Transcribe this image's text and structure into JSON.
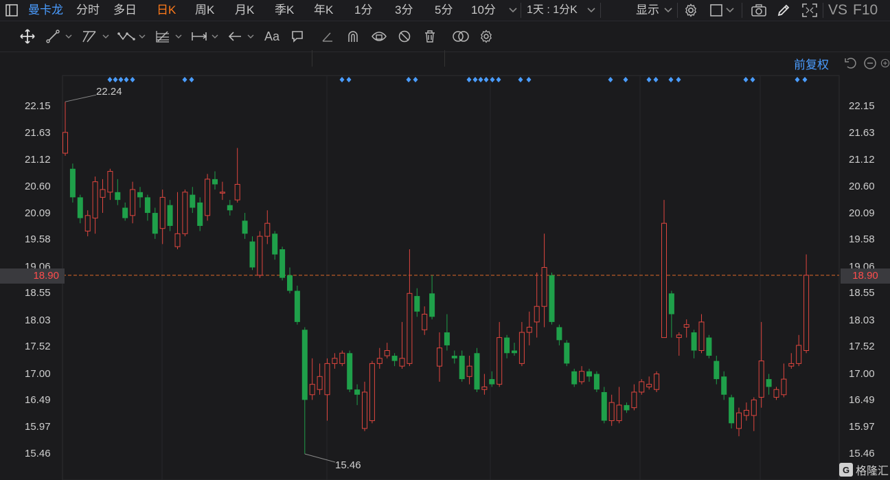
{
  "topbar": {
    "stock_name": "曼卡龙",
    "tabs": [
      "分时",
      "多日",
      "日K",
      "周K",
      "月K",
      "季K",
      "年K",
      "1分",
      "3分",
      "5分",
      "10分"
    ],
    "active_tab": "日K",
    "period_combo": "1天 : 1分K",
    "display_label": "显示",
    "vs_label": "VS",
    "f10_label": "F10"
  },
  "toolbar": {
    "text_tool": "Aa"
  },
  "chart": {
    "adjust_label": "前复权",
    "current_price_badge": "18.90",
    "high_label": "22.24",
    "low_label": "15.46",
    "price_labels": [
      "22.15",
      "21.63",
      "21.12",
      "20.60",
      "20.09",
      "19.58",
      "19.06",
      "18.55",
      "18.03",
      "17.52",
      "17.00",
      "16.49",
      "15.97",
      "15.46"
    ],
    "watermark": "格隆汇",
    "colors": {
      "up": "#e0463f",
      "down": "#1fa04a",
      "current_line": "#e06a2a",
      "event": "#4a9cff"
    }
  },
  "chart_data": {
    "type": "candlestick",
    "ylim": [
      15.3,
      22.45
    ],
    "current_price": 18.9,
    "high": 22.24,
    "low": 15.46,
    "candles": [
      [
        21.25,
        21.65,
        22.24,
        21.2
      ],
      [
        20.95,
        20.4,
        21.05,
        20.3
      ],
      [
        20.4,
        20.0,
        20.45,
        19.9
      ],
      [
        19.75,
        20.05,
        20.15,
        19.65
      ],
      [
        20.0,
        20.7,
        20.8,
        19.7
      ],
      [
        20.4,
        20.55,
        20.75,
        20.1
      ],
      [
        20.5,
        20.9,
        20.95,
        20.35
      ],
      [
        20.5,
        20.35,
        20.75,
        20.25
      ],
      [
        20.2,
        20.0,
        20.3,
        19.95
      ],
      [
        20.05,
        20.55,
        20.7,
        19.9
      ],
      [
        20.5,
        20.4,
        20.6,
        20.2
      ],
      [
        20.4,
        20.1,
        20.45,
        19.95
      ],
      [
        20.1,
        19.7,
        20.2,
        19.6
      ],
      [
        19.8,
        20.4,
        20.55,
        19.5
      ],
      [
        20.25,
        19.85,
        20.35,
        19.75
      ],
      [
        19.45,
        19.7,
        20.5,
        19.4
      ],
      [
        19.7,
        20.5,
        20.55,
        19.65
      ],
      [
        20.45,
        20.2,
        20.6,
        20.1
      ],
      [
        20.3,
        19.85,
        20.4,
        19.75
      ],
      [
        20.05,
        20.75,
        20.85,
        19.95
      ],
      [
        20.75,
        20.65,
        20.9,
        20.55
      ],
      [
        20.5,
        20.5,
        20.7,
        20.35
      ],
      [
        20.25,
        20.15,
        20.35,
        20.05
      ],
      [
        20.35,
        20.65,
        21.35,
        20.3
      ],
      [
        19.95,
        19.7,
        20.1,
        19.6
      ],
      [
        19.55,
        19.05,
        19.65,
        19.0
      ],
      [
        18.9,
        19.65,
        19.75,
        18.85
      ],
      [
        19.65,
        19.9,
        20.15,
        19.5
      ],
      [
        19.7,
        19.3,
        19.75,
        19.2
      ],
      [
        19.4,
        18.85,
        19.45,
        18.8
      ],
      [
        18.9,
        18.6,
        19.05,
        18.55
      ],
      [
        18.6,
        18.0,
        18.7,
        17.95
      ],
      [
        17.85,
        16.5,
        17.9,
        15.46
      ],
      [
        16.6,
        16.8,
        17.3,
        16.5
      ],
      [
        16.7,
        16.95,
        17.2,
        16.6
      ],
      [
        16.6,
        17.2,
        17.3,
        16.1
      ],
      [
        17.2,
        17.3,
        17.4,
        17.1
      ],
      [
        17.2,
        17.4,
        17.45,
        17.15
      ],
      [
        17.4,
        16.7,
        17.45,
        16.65
      ],
      [
        16.7,
        16.6,
        16.8,
        16.4
      ],
      [
        15.95,
        16.65,
        16.85,
        15.9
      ],
      [
        16.1,
        17.2,
        17.25,
        16.05
      ],
      [
        17.2,
        17.3,
        17.5,
        17.1
      ],
      [
        17.35,
        17.45,
        17.6,
        17.3
      ],
      [
        17.35,
        17.25,
        17.4,
        17.15
      ],
      [
        17.15,
        17.3,
        18.0,
        17.1
      ],
      [
        17.2,
        18.55,
        19.4,
        17.15
      ],
      [
        18.5,
        18.2,
        18.65,
        18.1
      ],
      [
        17.85,
        18.15,
        18.3,
        17.75
      ],
      [
        18.55,
        18.1,
        18.9,
        18.05
      ],
      [
        17.15,
        17.5,
        17.8,
        16.85
      ],
      [
        17.8,
        17.55,
        18.15,
        17.45
      ],
      [
        17.35,
        17.3,
        17.45,
        17.2
      ],
      [
        17.35,
        16.9,
        17.45,
        16.85
      ],
      [
        16.95,
        17.15,
        17.35,
        16.8
      ],
      [
        17.4,
        16.7,
        17.5,
        16.65
      ],
      [
        16.7,
        16.75,
        17.0,
        16.6
      ],
      [
        16.9,
        16.8,
        17.05,
        16.75
      ],
      [
        16.8,
        17.7,
        18.0,
        16.75
      ],
      [
        17.7,
        17.4,
        17.75,
        17.3
      ],
      [
        17.45,
        17.4,
        17.6,
        17.35
      ],
      [
        17.2,
        17.8,
        18.0,
        17.15
      ],
      [
        17.8,
        17.9,
        18.2,
        17.55
      ],
      [
        18.0,
        18.3,
        18.95,
        17.7
      ],
      [
        18.3,
        19.05,
        19.7,
        17.9
      ],
      [
        18.9,
        18.0,
        18.95,
        17.95
      ],
      [
        17.9,
        17.65,
        17.95,
        17.55
      ],
      [
        17.6,
        17.2,
        17.65,
        17.15
      ],
      [
        17.05,
        16.8,
        17.1,
        16.75
      ],
      [
        16.85,
        17.05,
        17.15,
        16.8
      ],
      [
        17.05,
        16.95,
        17.1,
        16.85
      ],
      [
        17.0,
        16.7,
        17.05,
        16.65
      ],
      [
        16.65,
        16.1,
        16.75,
        16.05
      ],
      [
        16.1,
        16.45,
        16.6,
        16.0
      ],
      [
        16.1,
        16.4,
        16.75,
        16.05
      ],
      [
        16.4,
        16.3,
        16.45,
        16.25
      ],
      [
        16.35,
        16.65,
        16.8,
        16.3
      ],
      [
        16.65,
        16.85,
        16.9,
        16.6
      ],
      [
        16.75,
        16.8,
        16.95,
        16.7
      ],
      [
        16.7,
        17.0,
        17.05,
        16.65
      ],
      [
        17.7,
        19.9,
        20.35,
        17.7
      ],
      [
        18.55,
        18.15,
        18.6,
        17.7
      ],
      [
        17.7,
        17.75,
        17.8,
        17.35
      ],
      [
        17.9,
        17.95,
        18.05,
        17.7
      ],
      [
        17.8,
        17.45,
        17.85,
        17.3
      ],
      [
        17.45,
        18.0,
        18.15,
        17.4
      ],
      [
        17.7,
        17.35,
        17.75,
        17.3
      ],
      [
        17.25,
        16.9,
        17.35,
        16.8
      ],
      [
        16.95,
        16.6,
        17.05,
        16.5
      ],
      [
        16.55,
        16.05,
        16.6,
        15.95
      ],
      [
        15.95,
        16.25,
        16.35,
        15.8
      ],
      [
        16.2,
        16.3,
        16.45,
        16.1
      ],
      [
        16.2,
        16.5,
        16.55,
        15.9
      ],
      [
        16.55,
        17.25,
        18.0,
        16.35
      ],
      [
        16.9,
        16.75,
        17.0,
        16.6
      ],
      [
        16.55,
        16.7,
        16.75,
        16.5
      ],
      [
        16.6,
        16.9,
        17.2,
        16.55
      ],
      [
        17.15,
        17.2,
        17.4,
        17.1
      ],
      [
        17.2,
        17.55,
        17.75,
        17.15
      ],
      [
        17.45,
        18.9,
        19.3,
        17.4
      ]
    ]
  }
}
